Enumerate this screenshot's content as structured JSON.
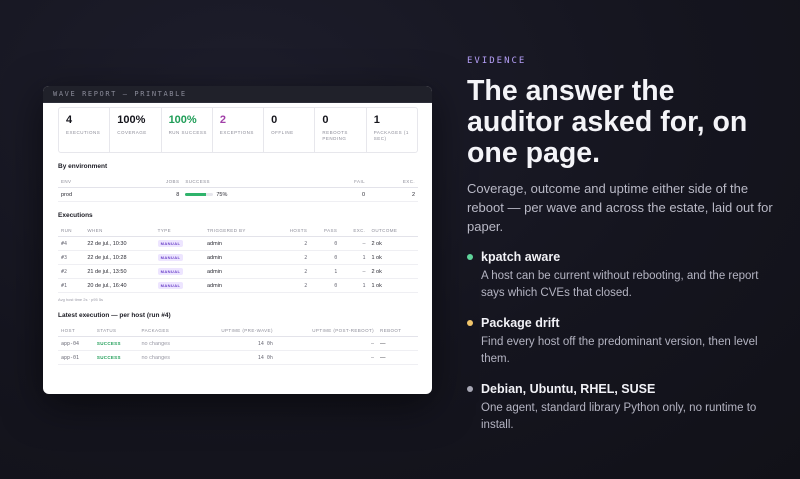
{
  "report": {
    "title": "WAVE REPORT — PRINTABLE",
    "stats": [
      {
        "value": "4",
        "label": "EXECUTIONS",
        "tone": "normal"
      },
      {
        "value": "100%",
        "label": "COVERAGE",
        "tone": "normal"
      },
      {
        "value": "100%",
        "label": "RUN SUCCESS",
        "tone": "green"
      },
      {
        "value": "2",
        "label": "EXCEPTIONS",
        "tone": "purple"
      },
      {
        "value": "0",
        "label": "OFFLINE",
        "tone": "normal"
      },
      {
        "value": "0",
        "label": "REBOOTS PENDING",
        "tone": "normal"
      },
      {
        "value": "1",
        "label": "PACKAGES (1 SEC)",
        "tone": "normal"
      }
    ],
    "by_env": {
      "title": "By environment",
      "headers": [
        "ENV",
        "JOBS",
        "SUCCESS",
        "FAIL",
        "EXC."
      ],
      "rows": [
        {
          "env": "prod",
          "jobs": "8",
          "success_text": "75%",
          "success_fraction": 0.75,
          "fail": "0",
          "exc": "2"
        }
      ]
    },
    "executions": {
      "title": "Executions",
      "headers": [
        "RUN",
        "WHEN",
        "TYPE",
        "TRIGGERED BY",
        "HOSTS",
        "PASS",
        "EXC.",
        "OUTCOME"
      ],
      "rows": [
        {
          "run": "#4",
          "when": "22 de jul., 10:30",
          "type": "MANUAL",
          "by": "admin",
          "hosts": "2",
          "pass": "0",
          "exc": "–",
          "outcome": "2 ok"
        },
        {
          "run": "#3",
          "when": "22 de jul., 10:28",
          "type": "MANUAL",
          "by": "admin",
          "hosts": "2",
          "pass": "0",
          "exc": "1",
          "outcome": "1 ok"
        },
        {
          "run": "#2",
          "when": "21 de jul., 13:50",
          "type": "MANUAL",
          "by": "admin",
          "hosts": "2",
          "pass": "1",
          "exc": "–",
          "outcome": "2 ok"
        },
        {
          "run": "#1",
          "when": "20 de jul., 16:40",
          "type": "MANUAL",
          "by": "admin",
          "hosts": "2",
          "pass": "0",
          "exc": "1",
          "outcome": "1 ok"
        }
      ],
      "footnote": "Avg host time 2s · p95 5s"
    },
    "latest": {
      "title": "Latest execution — per host (run #4)",
      "headers": [
        "HOST",
        "STATUS",
        "PACKAGES",
        "UPTIME (PRE-WAVE)",
        "UPTIME (POST-REBOOT)",
        "REBOOT"
      ],
      "rows": [
        {
          "host": "app-04",
          "status": "SUCCESS",
          "packages": "no changes",
          "uptime_pre": "14 0h",
          "uptime_post": "–",
          "reboot": "—"
        },
        {
          "host": "app-01",
          "status": "SUCCESS",
          "packages": "no changes",
          "uptime_pre": "14 0h",
          "uptime_post": "–",
          "reboot": "—"
        }
      ]
    }
  },
  "copy": {
    "eyebrow": "EVIDENCE",
    "headline": "The answer the auditor asked for, on one page.",
    "lead": "Coverage, outcome and uptime either side of the reboot — per wave and across the estate, laid out for paper.",
    "features": [
      {
        "title": "kpatch aware",
        "desc": "A host can be current without rebooting, and the report says which CVEs that closed.",
        "color": "#5fd39a"
      },
      {
        "title": "Package drift",
        "desc": "Find every host off the predominant version, then level them.",
        "color": "#f1c56b"
      },
      {
        "title": "Debian, Ubuntu, RHEL, SUSE",
        "desc": "One agent, standard library Python only, no runtime to install.",
        "color": "#a7a7b4"
      }
    ]
  }
}
